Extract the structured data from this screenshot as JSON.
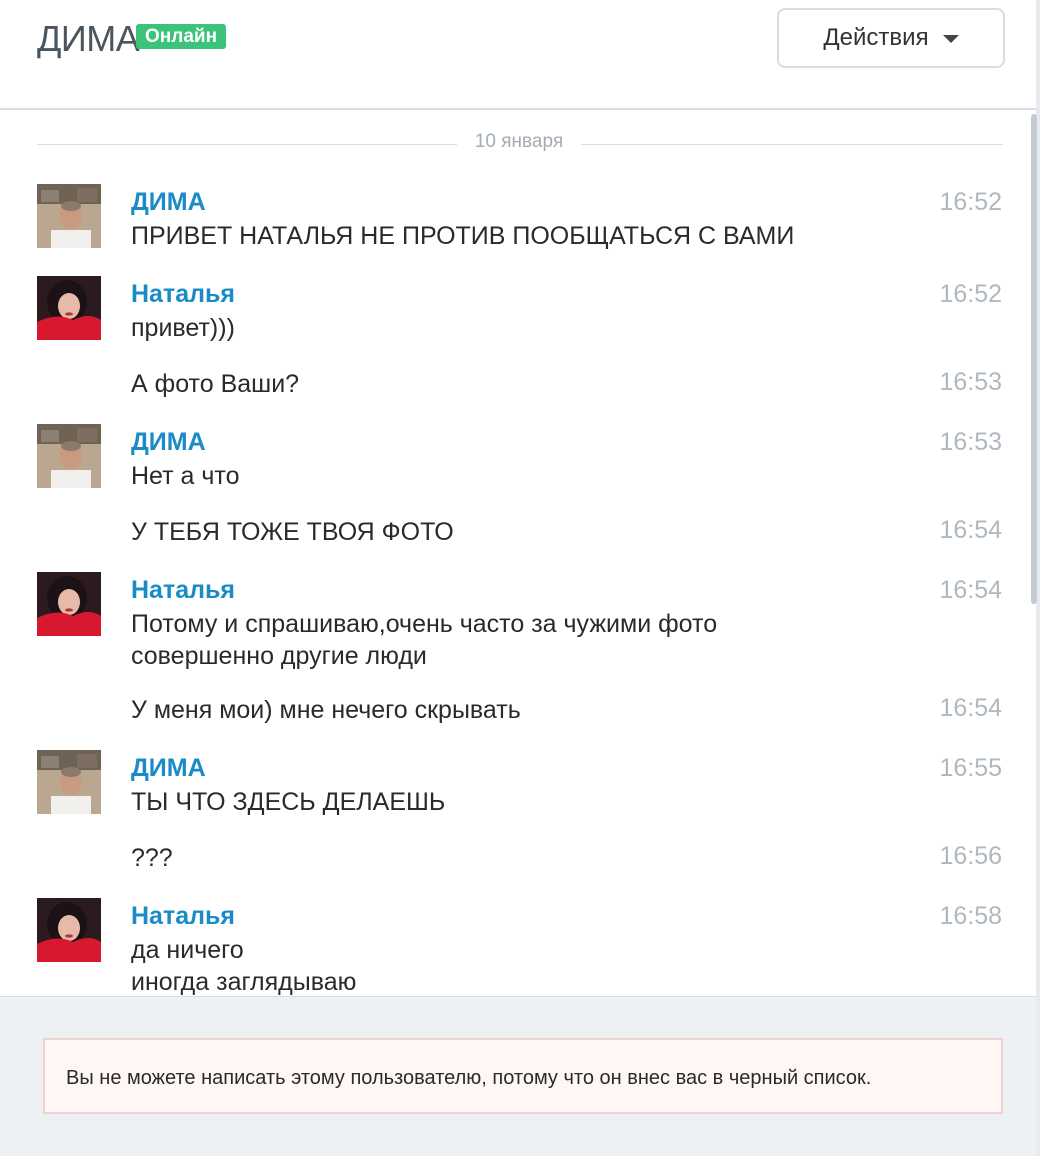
{
  "header": {
    "name": "ДИМА",
    "status": "Онлайн",
    "actions_label": "Действия"
  },
  "colors": {
    "accent": "#1a8bc7",
    "online": "#3cc37a",
    "muted": "#b0b8bf",
    "alert_bg": "#fff6f6",
    "alert_border": "#f2d1d1"
  },
  "date_separator": "10 января",
  "messages": [
    {
      "sender": "ДИМА",
      "text": "ПРИВЕТ НАТАЛЬЯ НЕ ПРОТИВ ПООБЩАТЬСЯ С ВАМИ",
      "time": "16:52"
    },
    {
      "sender": "Наталья",
      "text": "привет)))",
      "time": "16:52"
    },
    {
      "sender": "",
      "text": "А фото Ваши?",
      "time": "16:53"
    },
    {
      "sender": "ДИМА",
      "text": "Нет а что",
      "time": "16:53"
    },
    {
      "sender": "",
      "text": "У ТЕБЯ ТОЖЕ ТВОЯ ФОТО",
      "time": "16:54"
    },
    {
      "sender": "Наталья",
      "text": "Потому и спрашиваю,очень часто за чужими фото",
      "text2": "совершенно другие люди",
      "time": "16:54"
    },
    {
      "sender": "",
      "text": "У меня мои) мне нечего скрывать",
      "time": "16:54"
    },
    {
      "sender": "ДИМА",
      "text": "ТЫ ЧТО ЗДЕСЬ ДЕЛАЕШЬ",
      "time": "16:55"
    },
    {
      "sender": "",
      "text": "???",
      "time": "16:56"
    },
    {
      "sender": "Наталья",
      "text": "да ничего",
      "text2": "иногда заглядываю",
      "time": "16:58"
    }
  ],
  "footer": {
    "blocked_notice": "Вы не можете написать этому пользователю, потому что он внес вас в черный список."
  }
}
